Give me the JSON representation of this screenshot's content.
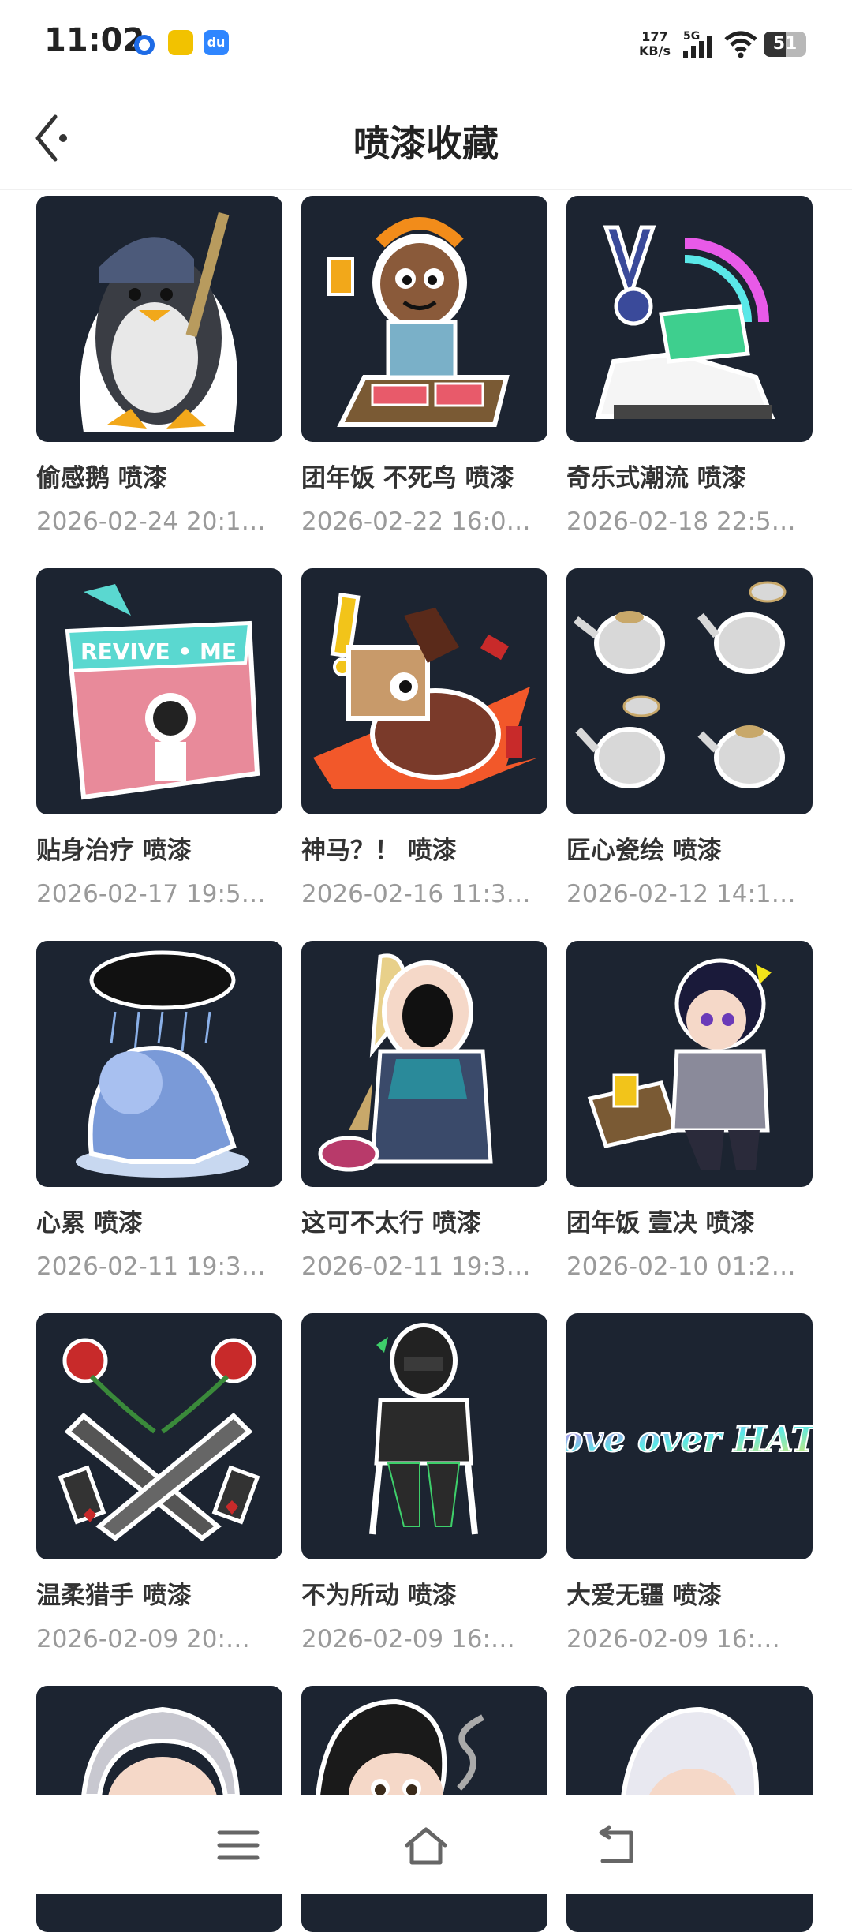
{
  "status_bar": {
    "time": "11:02",
    "net_speed_value": "177",
    "net_speed_unit": "KB/s",
    "network_type": "5G",
    "battery": "51",
    "battery_level": 0.51,
    "app_icons": [
      "qq-browser-icon",
      "app-icon-yellow",
      "baidu-icon"
    ]
  },
  "nav": {
    "title": "喷漆收藏",
    "back_icon": "back-arrow-icon"
  },
  "sprays": [
    {
      "name": "偷感鹅 喷漆",
      "date": "2026-02-24 20:1…"
    },
    {
      "name": "团年饭 不死鸟 喷漆",
      "date": "2026-02-22 16:0…"
    },
    {
      "name": "奇乐式潮流 喷漆",
      "date": "2026-02-18 22:5…"
    },
    {
      "name": "贴身治疗 喷漆",
      "date": "2026-02-17 19:5…",
      "art_text": "REVIVE • ME"
    },
    {
      "name": "神马？！ 喷漆",
      "date": "2026-02-16 11:3…"
    },
    {
      "name": "匠心瓷绘 喷漆",
      "date": "2026-02-12 14:1…"
    },
    {
      "name": "心累 喷漆",
      "date": "2026-02-11 19:3…"
    },
    {
      "name": "这可不太行 喷漆",
      "date": "2026-02-11 19:3…"
    },
    {
      "name": "团年饭 壹决 喷漆",
      "date": "2026-02-10 01:2…"
    },
    {
      "name": "温柔猎手 喷漆",
      "date": "2026-02-09 20:…"
    },
    {
      "name": "不为所动 喷漆",
      "date": "2026-02-09 16:…"
    },
    {
      "name": "大爱无疆 喷漆",
      "date": "2026-02-09 16:…",
      "art_text": "Love over HATE"
    },
    {
      "name": "",
      "date": ""
    },
    {
      "name": "",
      "date": ""
    },
    {
      "name": "",
      "date": ""
    }
  ],
  "system_nav": {
    "menu_icon": "menu-icon",
    "home_icon": "home-icon",
    "back_icon": "return-icon"
  },
  "colors": {
    "tile_bg": "#1c2431",
    "title_text": "#222222",
    "date_text": "#9a9a9a"
  }
}
